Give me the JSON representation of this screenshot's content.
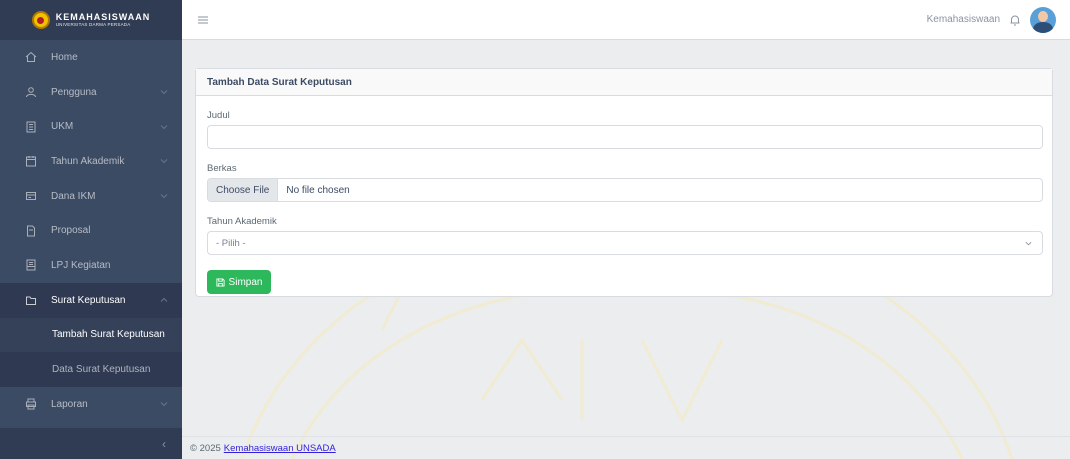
{
  "brand": {
    "title": "KEMAHASISWAAN",
    "subtitle": "UNIVERSITAS DARMA PERSADA",
    "logo_icon": "university-seal-icon"
  },
  "sidebar": {
    "items": [
      {
        "label": "Home",
        "icon": "home-icon",
        "has_children": false
      },
      {
        "label": "Pengguna",
        "icon": "user-icon",
        "has_children": true
      },
      {
        "label": "UKM",
        "icon": "building-icon",
        "has_children": true
      },
      {
        "label": "Tahun Akademik",
        "icon": "calendar-icon",
        "has_children": true
      },
      {
        "label": "Dana IKM",
        "icon": "wallet-icon",
        "has_children": true
      },
      {
        "label": "Proposal",
        "icon": "file-icon",
        "has_children": false
      },
      {
        "label": "LPJ Kegiatan",
        "icon": "document-icon",
        "has_children": false
      },
      {
        "label": "Surat Keputusan",
        "icon": "folder-icon",
        "has_children": true,
        "open": true,
        "children": [
          {
            "label": "Tambah Surat Keputusan",
            "active": true
          },
          {
            "label": "Data Surat Keputusan",
            "active": false
          }
        ]
      },
      {
        "label": "Laporan",
        "icon": "print-icon",
        "has_children": true
      }
    ],
    "minimizer_icon": "chevron-left-icon"
  },
  "header": {
    "user_label": "Kemahasiswaan",
    "toggler_icon": "hamburger-icon",
    "bell_icon": "bell-icon"
  },
  "form": {
    "title": "Tambah Data Surat Keputusan",
    "judul_label": "Judul",
    "judul_value": "",
    "berkas_label": "Berkas",
    "file_button": "Choose File",
    "file_name": "No file chosen",
    "tahun_label": "Tahun Akademik",
    "tahun_selected": "- Pilih -",
    "save_label": "Simpan"
  },
  "footer": {
    "copyright": "© 2025",
    "link_text": "Kemahasiswaan UNSADA"
  },
  "colors": {
    "sidebar": "#3c4b64",
    "accent_success": "#2eb85c",
    "link": "#321fdb"
  }
}
